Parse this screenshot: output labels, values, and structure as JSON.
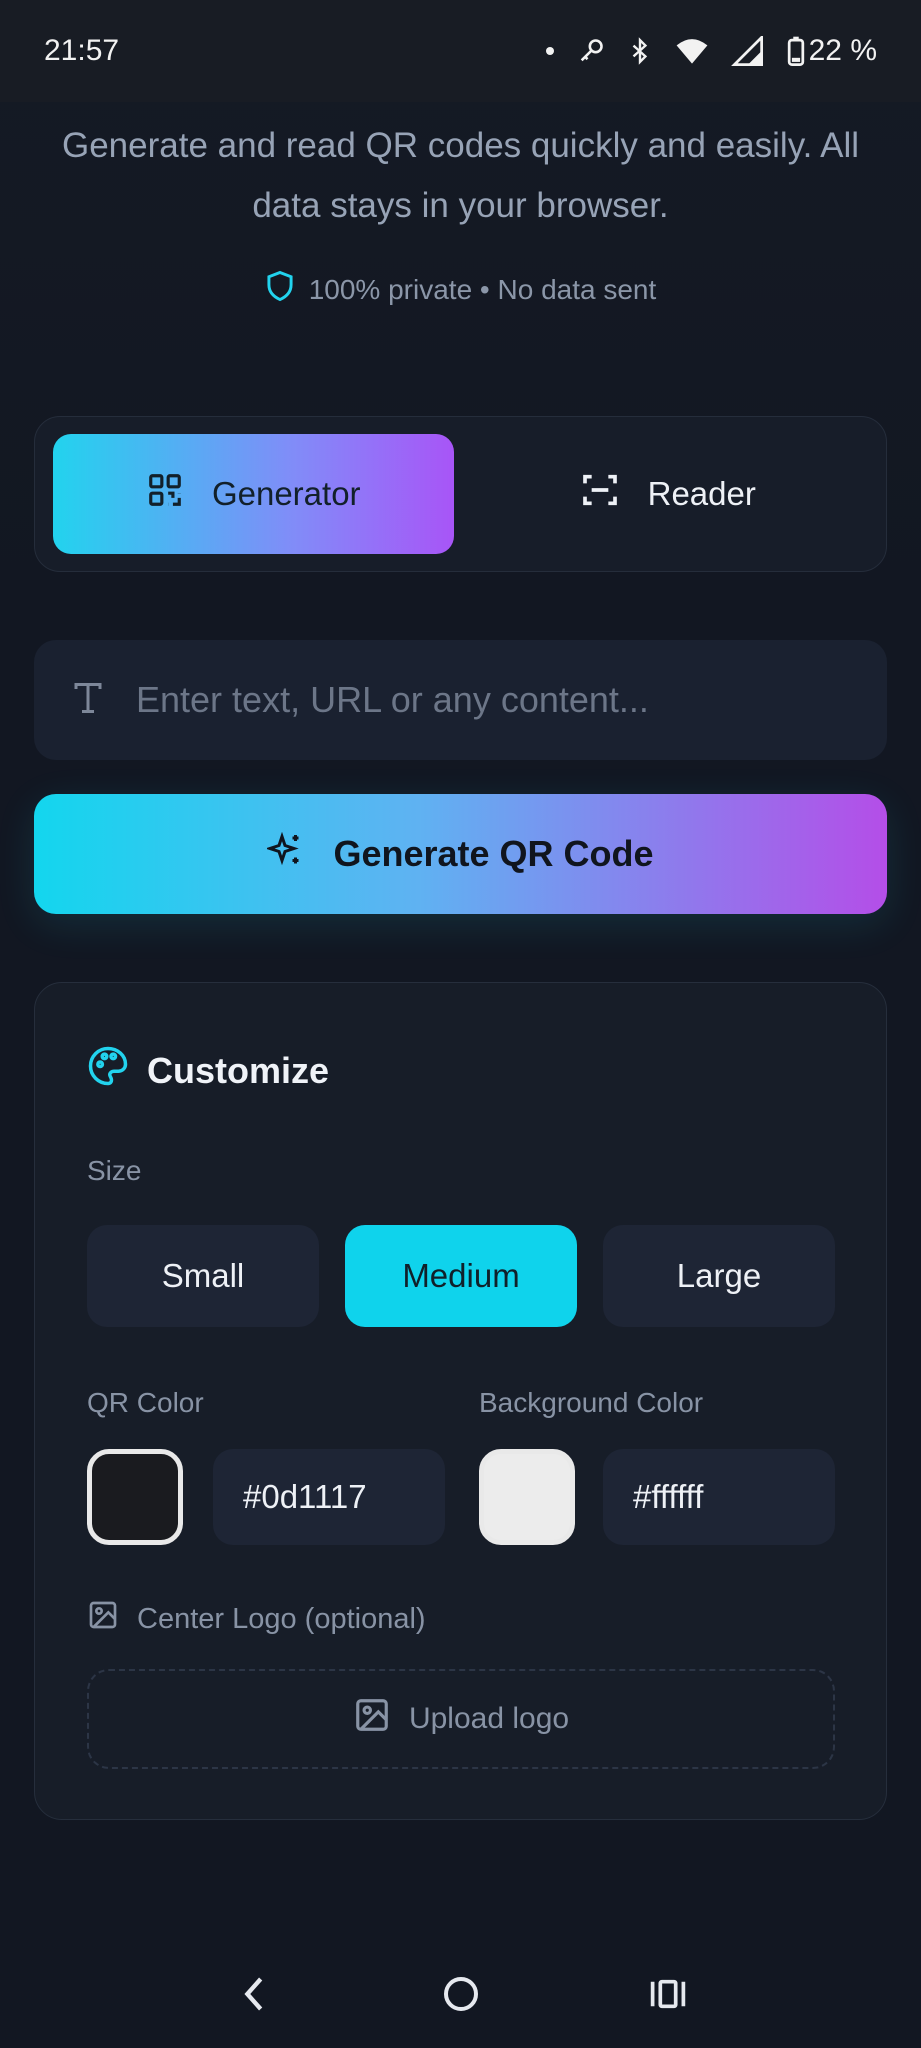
{
  "status_bar": {
    "time": "21:57",
    "battery": "22 %",
    "icons": [
      "dot-icon",
      "key-icon",
      "bluetooth-icon",
      "wifi-icon",
      "signal-icon",
      "battery-icon"
    ]
  },
  "intro": {
    "subtitle": "Generate and read QR codes quickly and easily. All data stays in your browser.",
    "privacy": "100% private • No data sent"
  },
  "tabs": [
    {
      "label": "Generator",
      "active": true,
      "icon": "qr-icon"
    },
    {
      "label": "Reader",
      "active": false,
      "icon": "scan-icon"
    }
  ],
  "input": {
    "placeholder": "Enter text, URL or any content...",
    "value": ""
  },
  "generate_button": {
    "label": "Generate QR Code",
    "icon": "sparkles-icon"
  },
  "customize": {
    "title": "Customize",
    "size_label": "Size",
    "sizes": [
      {
        "label": "Small",
        "active": false
      },
      {
        "label": "Medium",
        "active": true
      },
      {
        "label": "Large",
        "active": false
      }
    ],
    "qr_color_label": "QR Color",
    "qr_color": "#0d1117",
    "bg_color_label": "Background Color",
    "bg_color": "#ffffff",
    "logo_label": "Center Logo (optional)",
    "upload_label": "Upload logo"
  },
  "colors": {
    "accent_start": "#22d3ee",
    "accent_end": "#a855f7",
    "active_size": "#0fd3ec"
  }
}
